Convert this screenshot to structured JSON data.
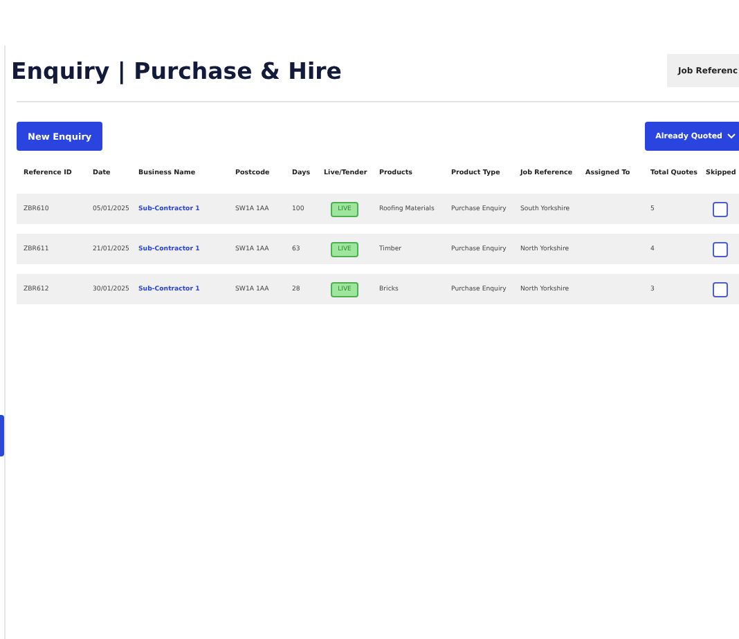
{
  "page": {
    "title": "Enquiry | Purchase & Hire",
    "job_reference_button": "Job Referenc"
  },
  "toolbar": {
    "new_button": "New Enquiry",
    "filter_dropdown": "Already Quoted"
  },
  "table": {
    "columns": [
      "Reference ID",
      "Date",
      "Business Name",
      "Postcode",
      "Days",
      "Live/Tender",
      "Products",
      "Product Type",
      "Job Reference",
      "Assigned To",
      "Total Quotes",
      "Skipped"
    ],
    "rows": [
      {
        "reference_id": "ZBR610",
        "date": "05/01/2025",
        "business_name": "Sub-Contractor 1",
        "postcode": "SW1A 1AA",
        "days": "100",
        "status": "LIVE",
        "products": "Roofing Materials",
        "product_type": "Purchase Enquiry",
        "job_reference": "South Yorkshire",
        "total_quotes": "5",
        "skipped": false
      },
      {
        "reference_id": "ZBR611",
        "date": "21/01/2025",
        "business_name": "Sub-Contractor 1",
        "postcode": "SW1A 1AA",
        "days": "63",
        "status": "LIVE",
        "products": "Timber",
        "product_type": "Purchase Enquiry",
        "job_reference": "North Yorkshire",
        "total_quotes": "4",
        "skipped": false
      },
      {
        "reference_id": "ZBR612",
        "date": "30/01/2025",
        "business_name": "Sub-Contractor 1",
        "postcode": "SW1A 1AA",
        "days": "28",
        "status": "LIVE",
        "products": "Bricks",
        "product_type": "Purchase Enquiry",
        "job_reference": "North Yorkshire",
        "total_quotes": "3",
        "skipped": false
      }
    ]
  }
}
